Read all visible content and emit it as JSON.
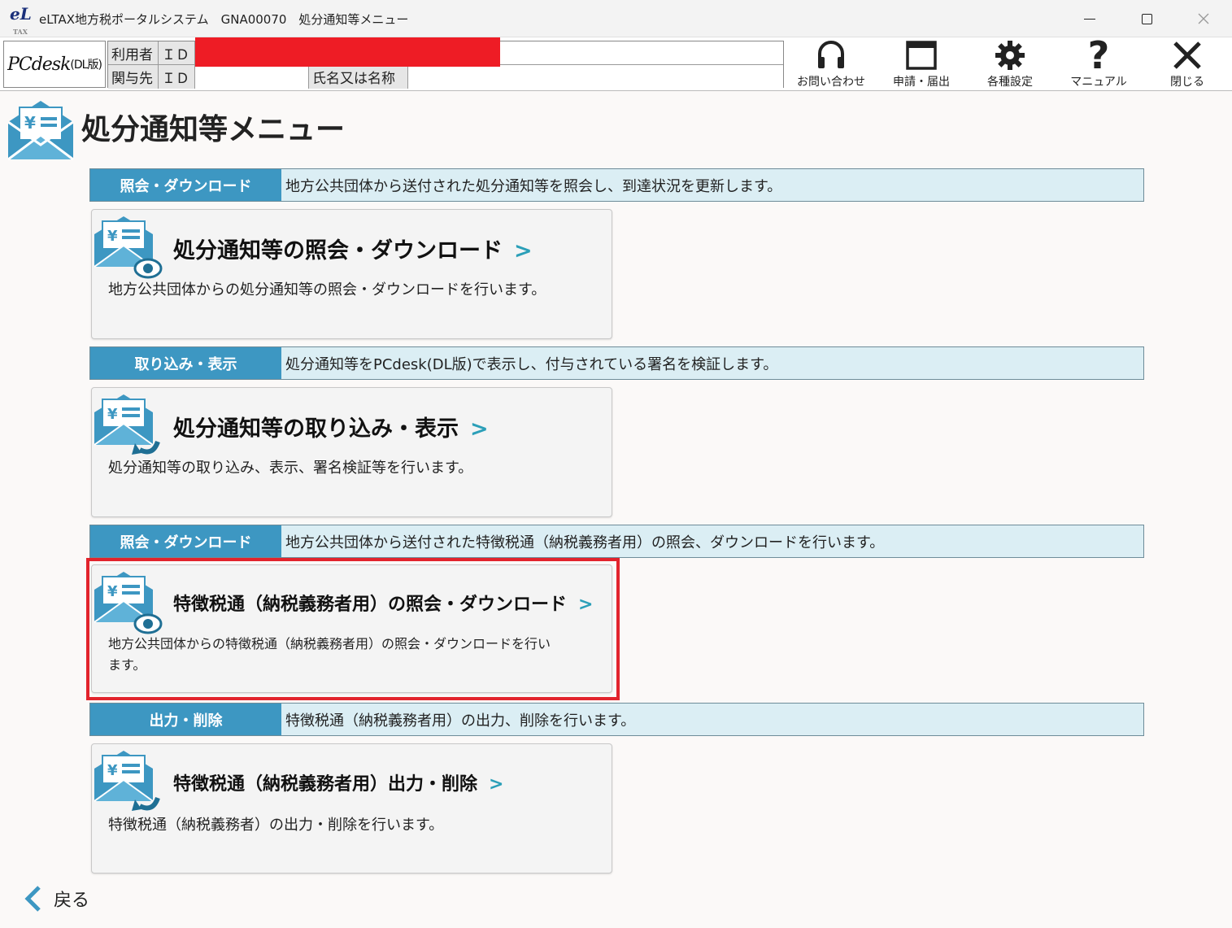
{
  "window": {
    "logo": "eL",
    "logo_sub": "TAX",
    "title": "eLTAX地方税ポータルシステム　GNA00070　処分通知等メニュー"
  },
  "header": {
    "app_logo": "PCdesk",
    "app_logo_sub": "(DL版)",
    "user_label": "利用者",
    "id_label": "ＩＤ",
    "agent_label": "関与先",
    "agent_id_label": "ＩＤ",
    "name_label": "氏名又は名称",
    "tools": [
      {
        "label": "お問い合わせ",
        "icon": "headset-icon"
      },
      {
        "label": "申請・届出",
        "icon": "window-icon"
      },
      {
        "label": "各種設定",
        "icon": "gear-icon"
      },
      {
        "label": "マニュアル",
        "icon": "question-icon"
      },
      {
        "label": "閉じる",
        "icon": "close-icon"
      }
    ]
  },
  "page": {
    "title": "処分通知等メニュー"
  },
  "sections": [
    {
      "tag": "照会・ダウンロード",
      "desc": "地方公共団体から送付された処分通知等を照会し、到達状況を更新します。",
      "card_title": "処分通知等の照会・ダウンロード",
      "card_desc": "地方公共団体からの処分通知等の照会・ダウンロードを行います。",
      "chevron": ">"
    },
    {
      "tag": "取り込み・表示",
      "desc": "処分通知等をPCdesk(DL版)で表示し、付与されている署名を検証します。",
      "card_title": "処分通知等の取り込み・表示",
      "card_desc": "処分通知等の取り込み、表示、署名検証等を行います。",
      "chevron": ">"
    },
    {
      "tag": "照会・ダウンロード",
      "desc": "地方公共団体から送付された特徴税通（納税義務者用）の照会、ダウンロードを行います。",
      "card_title": "特徴税通（納税義務者用）の照会・ダウンロード",
      "card_desc": "地方公共団体からの特徴税通（納税義務者用）の照会・ダウンロードを行い",
      "card_desc2": "ます。",
      "chevron": ">"
    },
    {
      "tag": "出力・削除",
      "desc": "特徴税通（納税義務者用）の出力、削除を行います。",
      "card_title": "特徴税通（納税義務者用）出力・削除",
      "card_desc": "特徴税通（納税義務者）の出力・削除を行います。",
      "chevron": ">"
    }
  ],
  "footer": {
    "back_label": "戻る"
  },
  "colors": {
    "tag_bg": "#3d97c2",
    "bar_bg": "#dbeef4",
    "chevron": "#2b9fb8",
    "highlight": "#e2232c",
    "redaction": "#ee1c25"
  }
}
